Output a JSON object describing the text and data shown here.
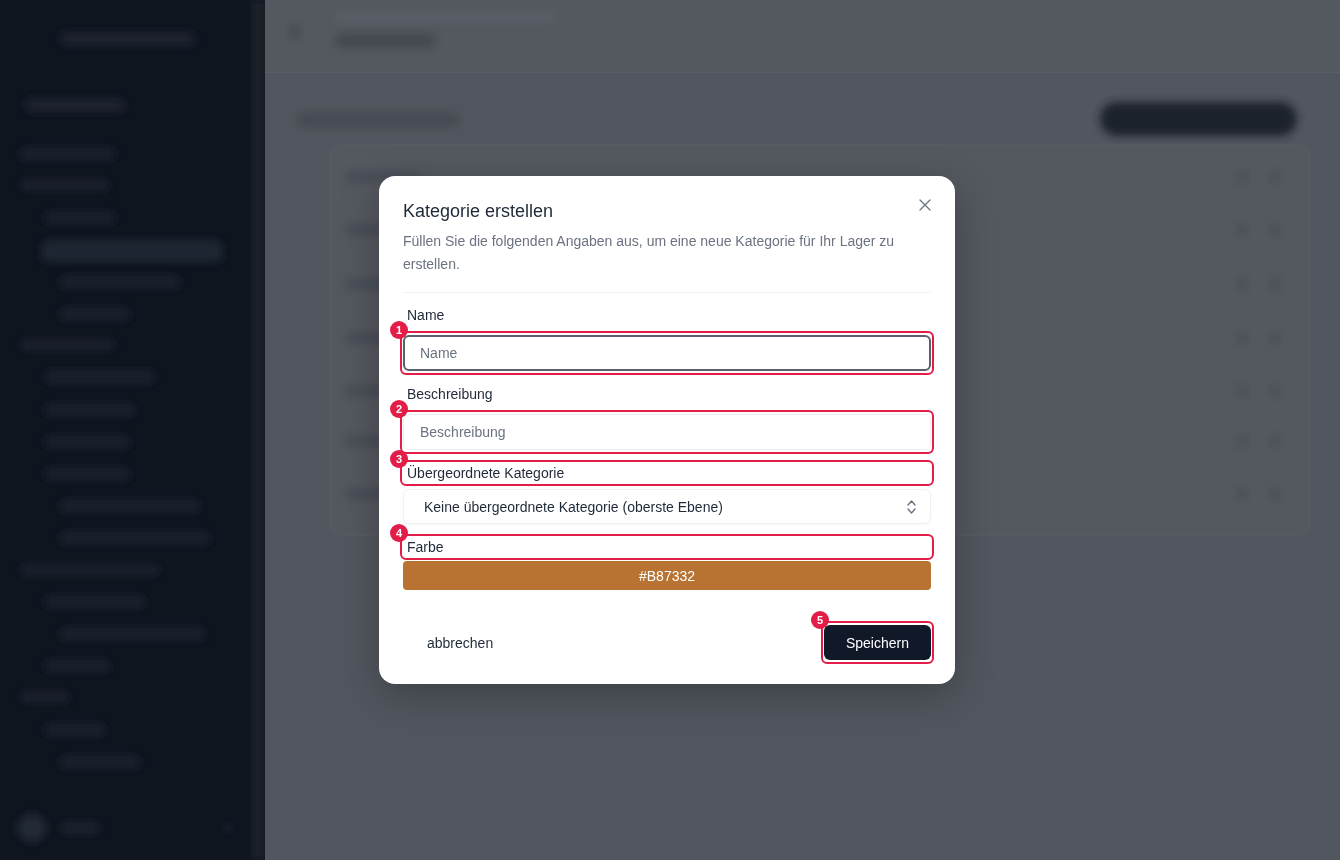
{
  "dialog": {
    "title": "Kategorie erstellen",
    "description": "Füllen Sie die folgenden Angaben aus, um eine neue Kategorie für Ihr Lager zu erstellen.",
    "fields": [
      {
        "kind": "text",
        "label": "Name",
        "placeholder": "Name",
        "focused": true,
        "annotation": {
          "number": "1",
          "kind": "control"
        }
      },
      {
        "kind": "text",
        "label": "Beschreibung",
        "placeholder": "Beschreibung",
        "focused": false,
        "annotation": {
          "number": "2",
          "kind": "control"
        }
      },
      {
        "kind": "select",
        "label": "Übergeordnete Kategorie",
        "value": "Keine übergeordnete Kategorie (oberste Ebene)",
        "annotation": {
          "number": "3",
          "kind": "label"
        }
      },
      {
        "kind": "color",
        "label": "Farbe",
        "value": "#B87332",
        "annotation": {
          "number": "4",
          "kind": "label"
        }
      }
    ],
    "buttons": [
      {
        "kind": "ghost",
        "label": "abbrechen"
      },
      {
        "kind": "primary",
        "label": "Speichern",
        "annotation": {
          "number": "5",
          "kind": "control"
        }
      }
    ]
  }
}
